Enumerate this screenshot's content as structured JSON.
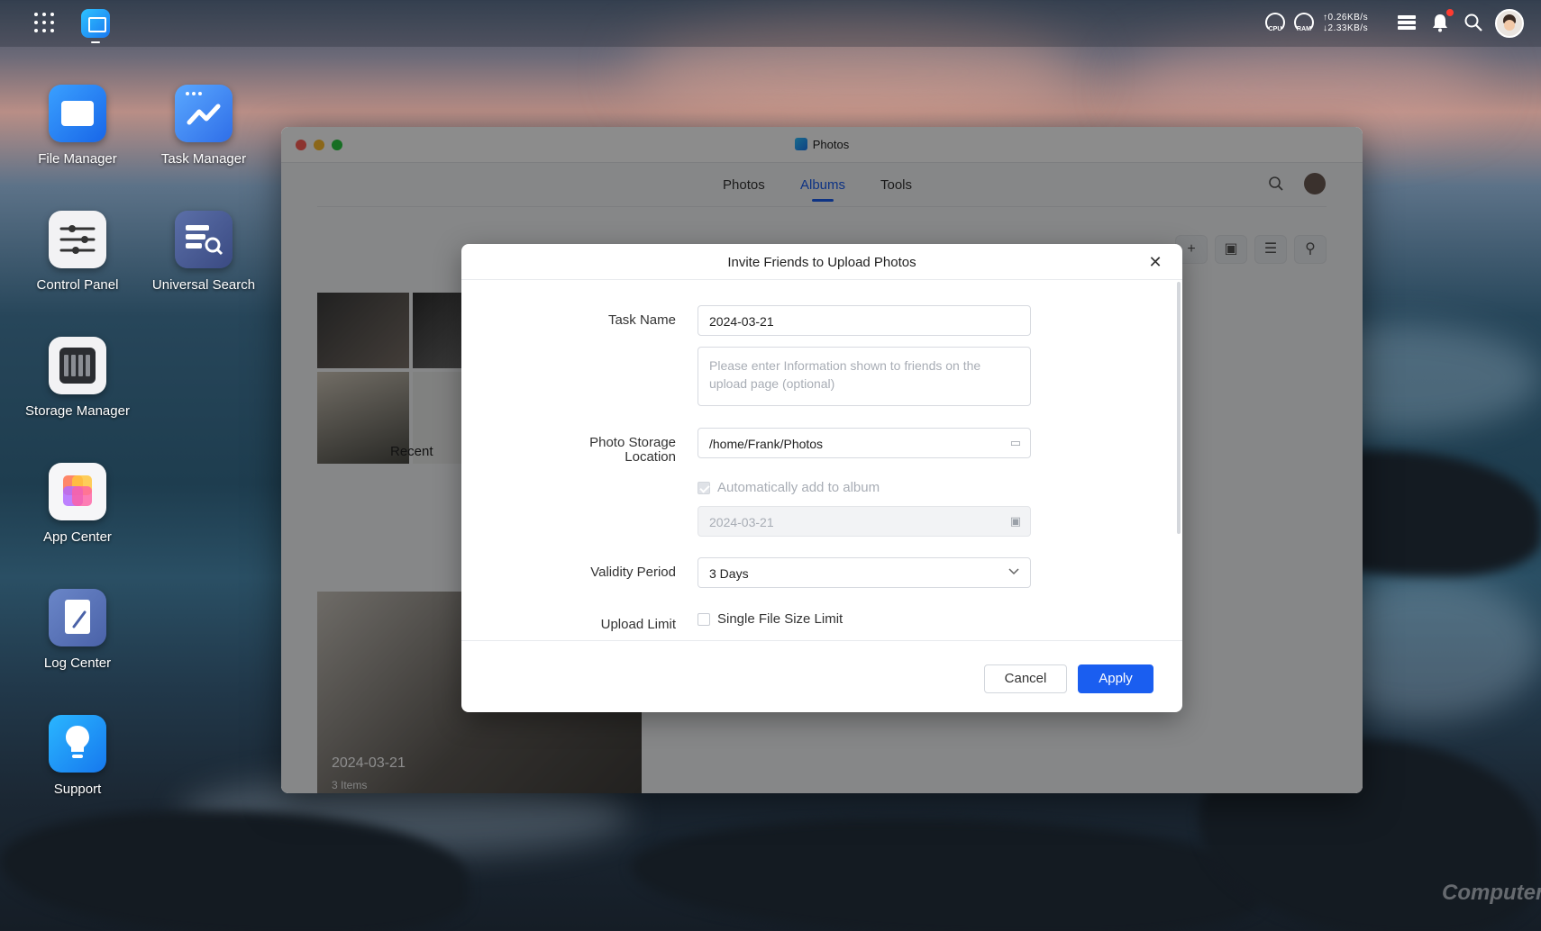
{
  "desktop": {
    "icons": [
      {
        "label": "File Manager"
      },
      {
        "label": "Task Manager"
      },
      {
        "label": "Control Panel"
      },
      {
        "label": "Universal Search"
      },
      {
        "label": "Storage Manager"
      },
      {
        "label": "App Center"
      },
      {
        "label": "Log Center"
      },
      {
        "label": "Support"
      }
    ]
  },
  "topbar": {
    "cpu_label": "CPU",
    "ram_label": "RAM",
    "upload_speed": "↑0.26KB/s",
    "download_speed": "↓2.33KB/s"
  },
  "window": {
    "title": "Photos",
    "tabs": [
      {
        "label": "Photos"
      },
      {
        "label": "Albums",
        "active": true
      },
      {
        "label": "Tools"
      }
    ],
    "albums": [
      {
        "label": "Recent"
      }
    ],
    "album_card": {
      "date": "2024-03-21",
      "count": "3 Items"
    }
  },
  "dialog": {
    "title": "Invite Friends to Upload Photos",
    "task_name_label": "Task Name",
    "task_name_value": "2024-03-21",
    "info_placeholder": "Please enter Information shown to friends on the upload page (optional)",
    "storage_label_line1": "Photo Storage",
    "storage_label_line2": "Location",
    "storage_value": "/home/Frank/Photos",
    "auto_add_label": "Automatically add to album",
    "album_name_value": "2024-03-21",
    "validity_label": "Validity Period",
    "validity_value": "3 Days",
    "upload_limit_label": "Upload Limit",
    "single_file_limit_label": "Single File Size Limit",
    "cancel_label": "Cancel",
    "apply_label": "Apply"
  },
  "watermark": "ComputerBase",
  "colors": {
    "accent": "#1a5ef0"
  }
}
